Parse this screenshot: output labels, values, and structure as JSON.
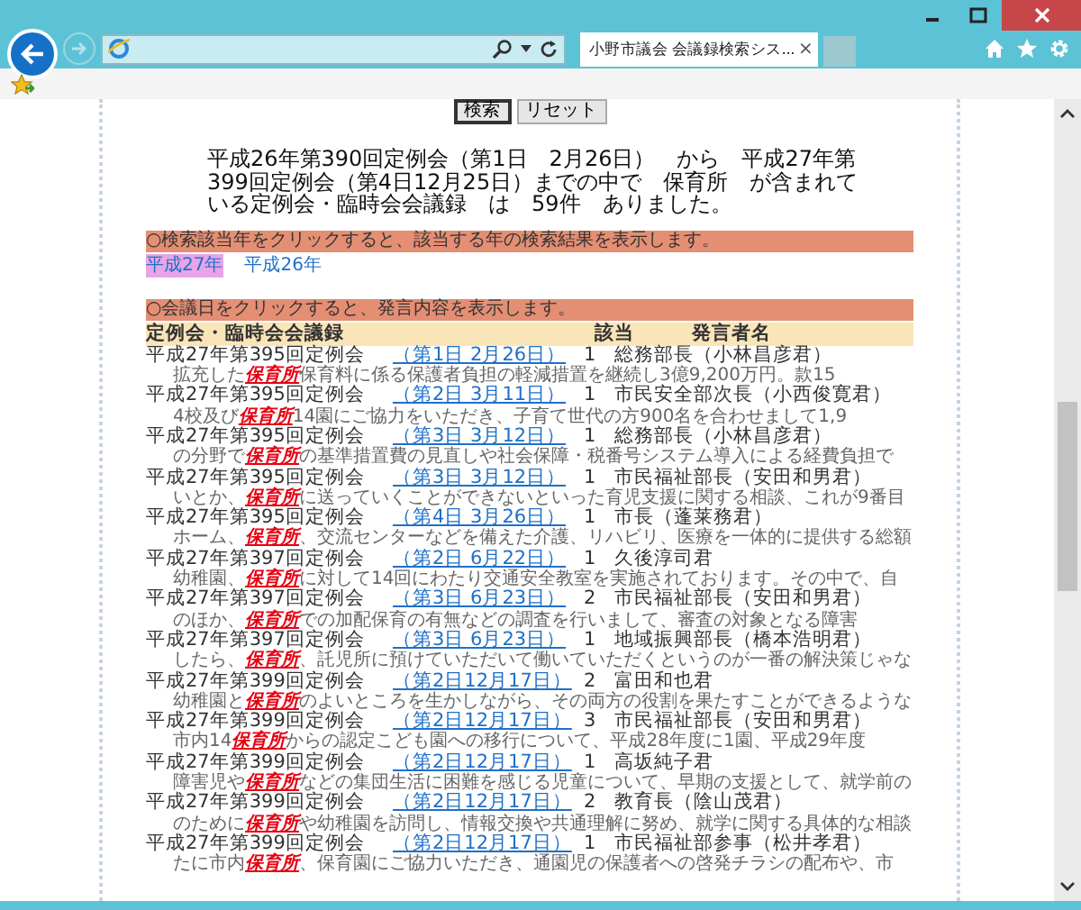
{
  "browser": {
    "tab_title": "小野市議会 会議録検索シス...",
    "tab_close": "×"
  },
  "buttons": [
    {
      "label": "検索",
      "focused": true
    },
    {
      "label": "リセット",
      "focused": false
    }
  ],
  "summary": "平成26年第390回定例会（第1日　2月26日）　から　平成27年第399回定例会（第4日12月25日）までの中で　保育所　が含まれている定例会・臨時会会議録　は　59件　ありました。",
  "year_notice": "○検索該当年をクリックすると、該当する年の検索結果を表示します。",
  "years": [
    {
      "label": "平成27年",
      "selected": true
    },
    {
      "label": "平成26年",
      "selected": false
    }
  ],
  "date_notice": "○会議日をクリックすると、発言内容を表示します。",
  "table": {
    "columns": [
      "定例会・臨時会会議録",
      "該当",
      "発言者名"
    ],
    "rows": [
      {
        "meeting": "平成27年第395回定例会",
        "date": "（第1日 2月26日）",
        "count": "1",
        "speaker": "総務部長（小林昌彦君）",
        "snippet": {
          "before": "拡充した",
          "keyword": "保育所",
          "after": "保育料に係る保護者負担の軽減措置を継続し3億9,200万円。款15"
        }
      },
      {
        "meeting": "平成27年第395回定例会",
        "date": "（第2日 3月11日）",
        "count": "1",
        "speaker": "市民安全部次長（小西俊寛君）",
        "snippet": {
          "before": "4校及び",
          "keyword": "保育所",
          "after": "14園にご協力をいただき、子育て世代の方900名を合わせまして1,9"
        }
      },
      {
        "meeting": "平成27年第395回定例会",
        "date": "（第3日 3月12日）",
        "count": "1",
        "speaker": "総務部長（小林昌彦君）",
        "snippet": {
          "before": "の分野で",
          "keyword": "保育所",
          "after": "の基準措置費の見直しや社会保障・税番号システム導入による経費負担で"
        }
      },
      {
        "meeting": "平成27年第395回定例会",
        "date": "（第3日 3月12日）",
        "count": "1",
        "speaker": "市民福祉部長（安田和男君）",
        "snippet": {
          "before": "いとか、",
          "keyword": "保育所",
          "after": "に送っていくことができないといった育児支援に関する相談、これが9番目"
        }
      },
      {
        "meeting": "平成27年第395回定例会",
        "date": "（第4日 3月26日）",
        "count": "1",
        "speaker": "市長（蓬莱務君）",
        "snippet": {
          "before": "ホーム、",
          "keyword": "保育所",
          "after": "、交流センターなどを備えた介護、リハビリ、医療を一体的に提供する総額"
        }
      },
      {
        "meeting": "平成27年第397回定例会",
        "date": "（第2日 6月22日）",
        "count": "1",
        "speaker": "久後淳司君",
        "snippet": {
          "before": "幼稚園、",
          "keyword": "保育所",
          "after": "に対して14回にわたり交通安全教室を実施されております。その中で、自"
        }
      },
      {
        "meeting": "平成27年第397回定例会",
        "date": "（第3日 6月23日）",
        "count": "2",
        "speaker": "市民福祉部長（安田和男君）",
        "snippet": {
          "before": "のほか、",
          "keyword": "保育所",
          "after": "での加配保育の有無などの調査を行いまして、審査の対象となる障害"
        }
      },
      {
        "meeting": "平成27年第397回定例会",
        "date": "（第3日 6月23日）",
        "count": "1",
        "speaker": "地域振興部長（橋本浩明君）",
        "snippet": {
          "before": "したら、",
          "keyword": "保育所",
          "after": "、託児所に預けていただいて働いていただくというのが一番の解決策じゃな"
        }
      },
      {
        "meeting": "平成27年第399回定例会",
        "date": "（第2日12月17日）",
        "count": "2",
        "speaker": "富田和也君",
        "snippet": {
          "before": "幼稚園と",
          "keyword": "保育所",
          "after": "のよいところを生かしながら、その両方の役割を果たすことができるような"
        }
      },
      {
        "meeting": "平成27年第399回定例会",
        "date": "（第2日12月17日）",
        "count": "3",
        "speaker": "市民福祉部長（安田和男君）",
        "snippet": {
          "before": "市内14",
          "keyword": "保育所",
          "after": "からの認定こども園への移行について、平成28年度に1園、平成29年度"
        }
      },
      {
        "meeting": "平成27年第399回定例会",
        "date": "（第2日12月17日）",
        "count": "1",
        "speaker": "高坂純子君",
        "snippet": {
          "before": "障害児や",
          "keyword": "保育所",
          "after": "などの集団生活に困難を感じる児童について、早期の支援として、就学前の"
        }
      },
      {
        "meeting": "平成27年第399回定例会",
        "date": "（第2日12月17日）",
        "count": "2",
        "speaker": "教育長（陰山茂君）",
        "snippet": {
          "before": "のために",
          "keyword": "保育所",
          "after": "や幼稚園を訪問し、情報交換や共通理解に努め、就学に関する具体的な相談"
        }
      },
      {
        "meeting": "平成27年第399回定例会",
        "date": "（第2日12月17日）",
        "count": "1",
        "speaker": "市民福祉部参事（松井孝君）",
        "snippet": {
          "before": "たに市内",
          "keyword": "保育所",
          "after": "、保育園にご協力いただき、通園児の保護者への啓発チラシの配布や、市"
        }
      }
    ]
  }
}
